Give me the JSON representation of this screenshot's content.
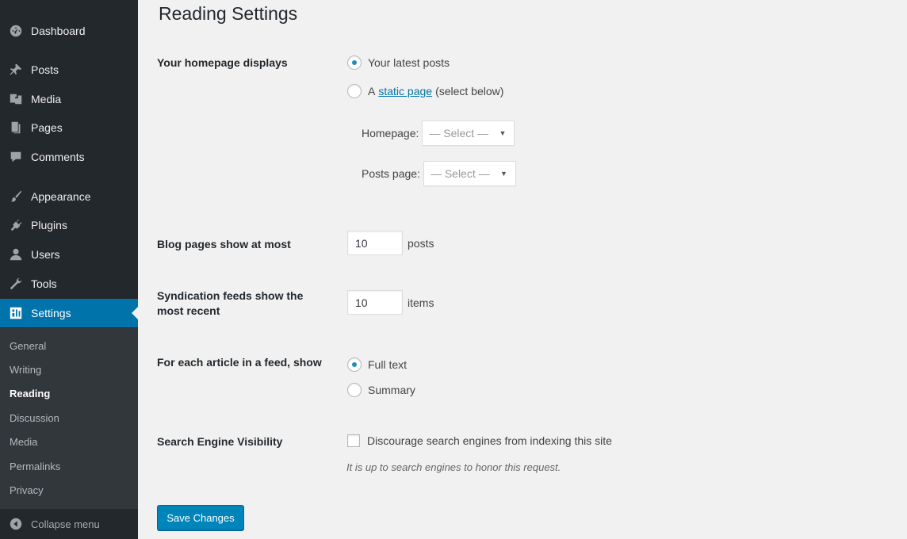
{
  "sidebar": {
    "items": [
      {
        "label": "Dashboard",
        "icon": "dashboard-icon"
      },
      {
        "label": "Posts",
        "icon": "pin-icon"
      },
      {
        "label": "Media",
        "icon": "media-icon"
      },
      {
        "label": "Pages",
        "icon": "pages-icon"
      },
      {
        "label": "Comments",
        "icon": "comment-icon"
      },
      {
        "label": "Appearance",
        "icon": "brush-icon"
      },
      {
        "label": "Plugins",
        "icon": "plugin-icon"
      },
      {
        "label": "Users",
        "icon": "user-icon"
      },
      {
        "label": "Tools",
        "icon": "wrench-icon"
      },
      {
        "label": "Settings",
        "icon": "settings-icon"
      }
    ],
    "submenu": [
      "General",
      "Writing",
      "Reading",
      "Discussion",
      "Media",
      "Permalinks",
      "Privacy"
    ],
    "collapse_label": "Collapse menu",
    "accent_color": "#0073aa"
  },
  "page": {
    "title": "Reading Settings",
    "homepage_displays": {
      "label": "Your homepage displays",
      "option_latest": "Your latest posts",
      "option_static_prefix": "A",
      "option_static_link": "static page",
      "option_static_suffix": "(select below)",
      "selected": "latest",
      "homepage_label": "Homepage:",
      "homepage_value": "— Select —",
      "posts_page_label": "Posts page:",
      "posts_page_value": "— Select —"
    },
    "blog_pages": {
      "label": "Blog pages show at most",
      "value": "10",
      "unit": "posts"
    },
    "syndication": {
      "label_line1": "Syndication feeds show the",
      "label_line2": "most recent",
      "value": "10",
      "unit": "items"
    },
    "feed_article": {
      "label": "For each article in a feed, show",
      "option_full": "Full text",
      "option_summary": "Summary",
      "selected": "full"
    },
    "search_visibility": {
      "label": "Search Engine Visibility",
      "checkbox_label": "Discourage search engines from indexing this site",
      "checked": false,
      "description": "It is up to search engines to honor this request."
    },
    "save_label": "Save Changes"
  }
}
